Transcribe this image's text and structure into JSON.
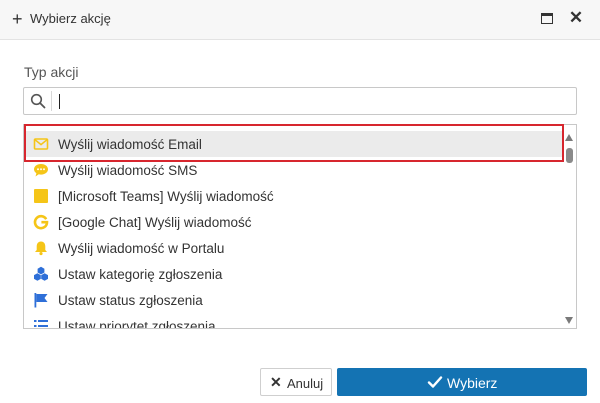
{
  "dialog": {
    "title": "Wybierz akcję",
    "title_icon": "plus-icon",
    "maximize_icon": "maximize-icon",
    "close_icon": "close-icon"
  },
  "field": {
    "label": "Typ akcji",
    "search_value": "",
    "search_icon": "search-icon"
  },
  "actions": [
    {
      "label": "Wyślij wiadomość Email",
      "icon": "envelope-icon",
      "selected": true
    },
    {
      "label": "Wyślij wiadomość SMS",
      "icon": "sms-bubble-icon"
    },
    {
      "label": "[Microsoft Teams] Wyślij wiadomość",
      "icon": "teams-square-icon"
    },
    {
      "label": "[Google Chat] Wyślij wiadomość",
      "icon": "google-g-icon"
    },
    {
      "label": "Wyślij wiadomość w Portalu",
      "icon": "bell-icon"
    },
    {
      "label": "Ustaw kategorię zgłoszenia",
      "icon": "cubes-icon"
    },
    {
      "label": "Ustaw status zgłoszenia",
      "icon": "flag-icon"
    },
    {
      "label": "Ustaw priorytet zgłoszenia",
      "icon": "priority-list-icon"
    }
  ],
  "buttons": {
    "cancel_label": "Anuluj",
    "ok_label": "Wybierz"
  },
  "colors": {
    "primary": "#1473b3",
    "highlight_frame": "#d7262e",
    "selected_row": "#ebebeb",
    "icon_yellow": "#f5c518",
    "icon_blue": "#2e6fd8"
  }
}
